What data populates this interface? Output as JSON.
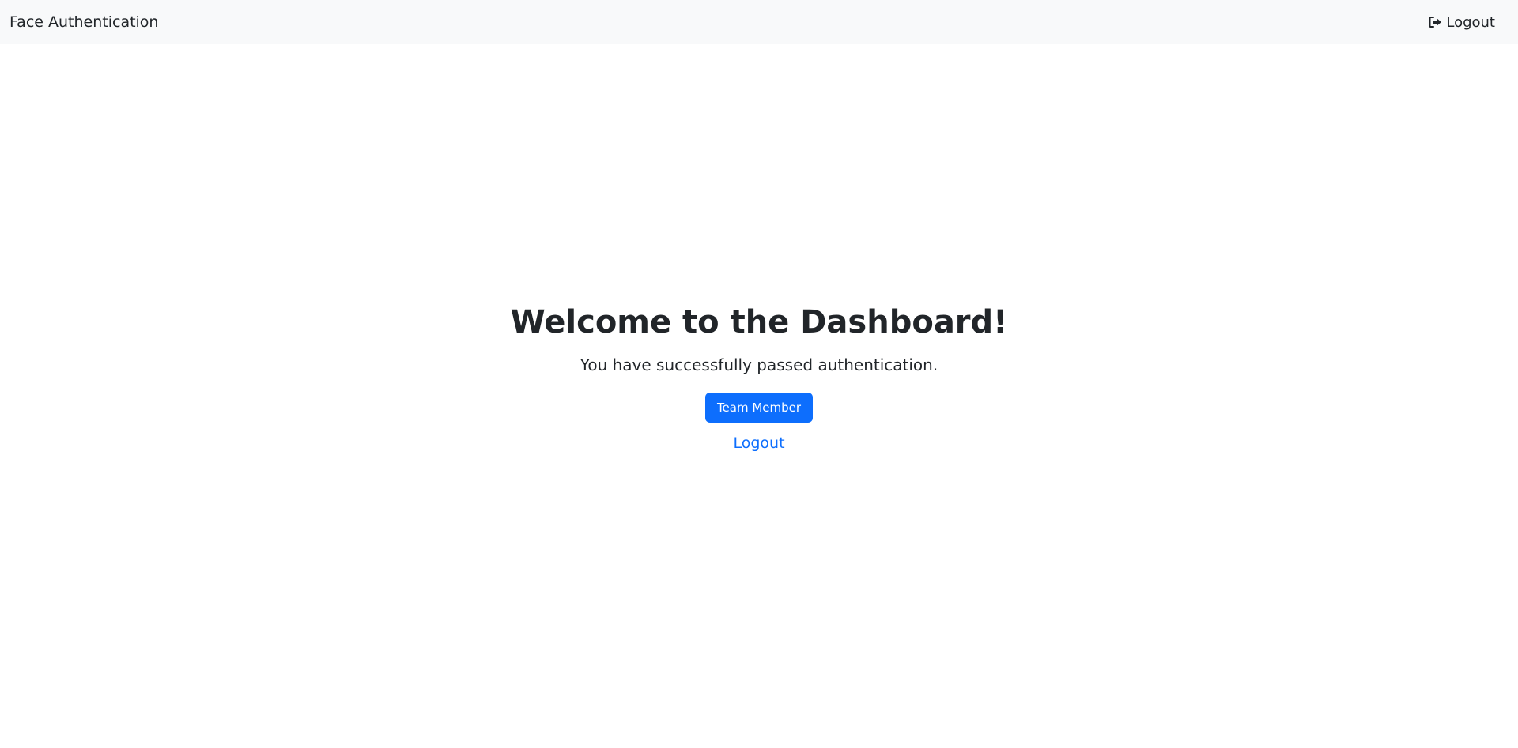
{
  "navbar": {
    "brand": "Face Authentication",
    "logout_label": "Logout",
    "logout_icon": "sign-out-icon"
  },
  "main": {
    "title": "Welcome to the Dashboard!",
    "subtitle": "You have successfully passed authentication.",
    "team_button_label": "Team Member",
    "logout_link_label": "Logout"
  },
  "colors": {
    "primary": "#0d6efd",
    "navbar_bg": "#f8f9fa",
    "text": "#212529"
  }
}
